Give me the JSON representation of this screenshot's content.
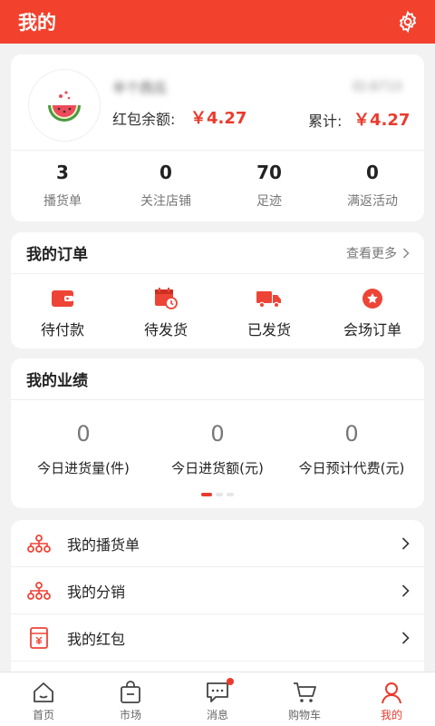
{
  "header": {
    "title": "我的"
  },
  "profile": {
    "nickname": "半个西瓜",
    "uid": "ID:8710",
    "balance_label": "红包余额:",
    "balance_value": "￥4.27",
    "total_label": "累计:",
    "total_value": "￥4.27",
    "stats": [
      {
        "value": "3",
        "label": "播货单"
      },
      {
        "value": "0",
        "label": "关注店铺"
      },
      {
        "value": "70",
        "label": "足迹"
      },
      {
        "value": "0",
        "label": "满返活动"
      }
    ]
  },
  "orders": {
    "title": "我的订单",
    "more_label": "查看更多",
    "items": [
      {
        "label": "待付款",
        "icon": "wallet-icon"
      },
      {
        "label": "待发货",
        "icon": "calendar-clock-icon"
      },
      {
        "label": "已发货",
        "icon": "truck-icon"
      },
      {
        "label": "会场订单",
        "icon": "star-badge-icon"
      }
    ]
  },
  "performance": {
    "title": "我的业绩",
    "items": [
      {
        "value": "0",
        "label": "今日进货量(件)"
      },
      {
        "value": "0",
        "label": "今日进货额(元)"
      },
      {
        "value": "0",
        "label": "今日预计代费(元)"
      }
    ],
    "page_count": 3,
    "active_page": 1
  },
  "menu": {
    "items": [
      {
        "label": "我的播货单",
        "icon": "org-tree-icon"
      },
      {
        "label": "我的分销",
        "icon": "org-tree-icon"
      },
      {
        "label": "我的红包",
        "icon": "red-envelope-icon"
      }
    ]
  },
  "tabbar": {
    "items": [
      {
        "label": "首页",
        "icon": "home-icon"
      },
      {
        "label": "市场",
        "icon": "bag-icon"
      },
      {
        "label": "消息",
        "icon": "message-icon"
      },
      {
        "label": "购物车",
        "icon": "cart-icon"
      },
      {
        "label": "我的",
        "icon": "user-icon"
      }
    ],
    "active": "我的"
  },
  "colors": {
    "accent": "#f2412d",
    "price": "#e93b2d"
  }
}
